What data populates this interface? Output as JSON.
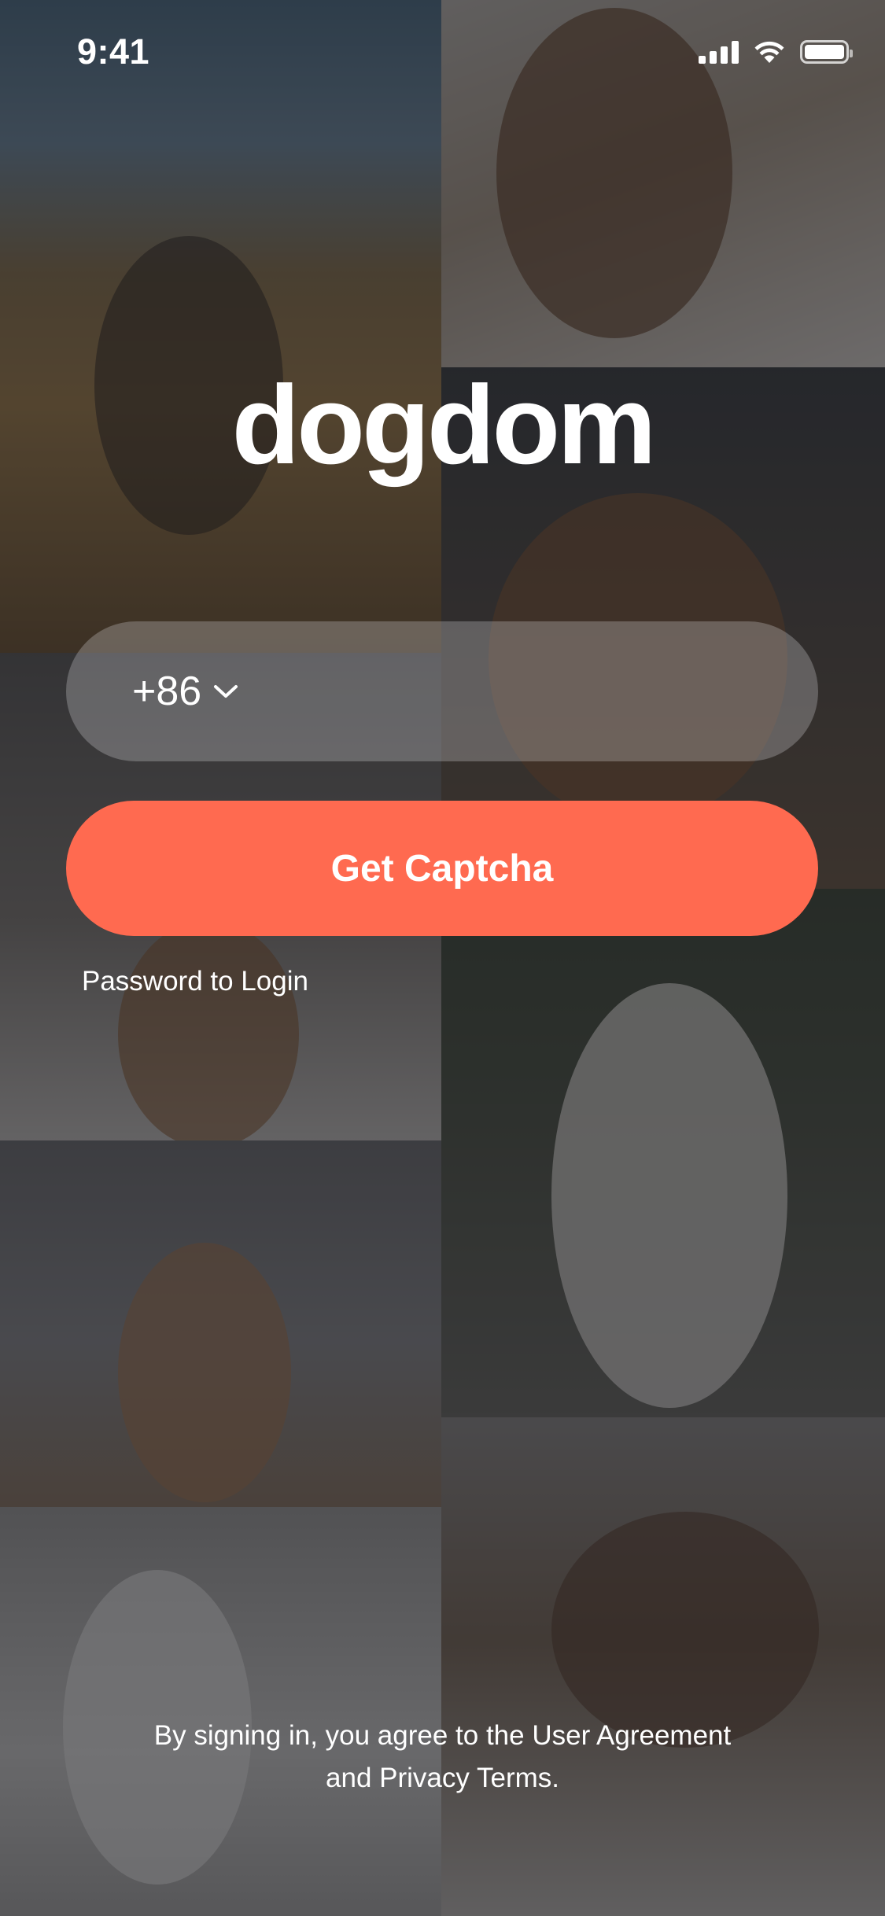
{
  "status_bar": {
    "time": "9:41",
    "icons": [
      "signal-icon",
      "wifi-icon",
      "battery-icon"
    ]
  },
  "logo": {
    "text": "dogdom"
  },
  "login": {
    "country_code": "+86",
    "phone_value": "",
    "captcha_label": "Get Captcha",
    "password_login_label": "Password to Login"
  },
  "terms": {
    "prefix": "By signing in, you agree to the ",
    "user_agreement": "User Agreement",
    "and": "and ",
    "privacy_terms": "Privacy Terms",
    "suffix": "."
  },
  "colors": {
    "accent": "#ff6a50",
    "text": "#ffffff",
    "field_bg": "rgba(235,235,240,0.26)"
  },
  "background_tiles": [
    "dog-photo-border-collie",
    "dog-photo-poodle-bed",
    "dog-photo-spaniel-car",
    "dog-photo-poodle-blanket",
    "dog-photo-samoyed",
    "dog-photo-spaniel-beach",
    "dog-photo-white-poodle",
    "dog-photo-yorkie-sleeping"
  ]
}
